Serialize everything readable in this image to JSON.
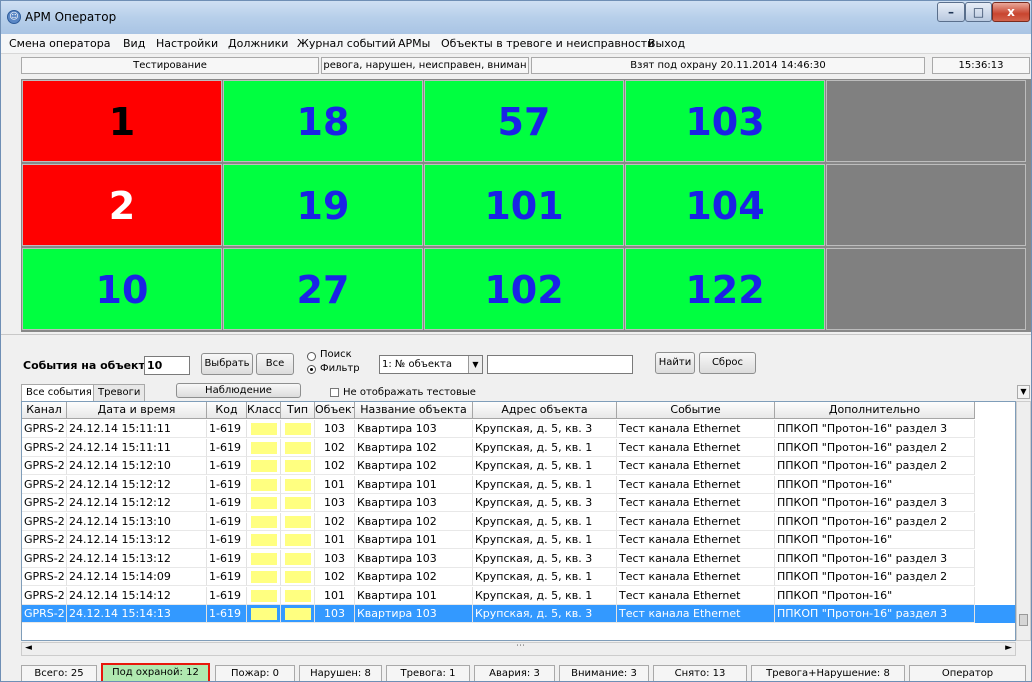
{
  "window": {
    "title": "АРМ Оператор",
    "min": "–",
    "max": "□",
    "close": "x"
  },
  "menu": [
    "Смена оператора",
    "Вид",
    "Настройки",
    "Должники",
    "Журнал событий",
    "АРМы",
    "Объекты в тревоге и неисправности",
    "Выход"
  ],
  "status_top": {
    "mode": "Тестирование",
    "filter": "ревога, нарушен, неисправен, вниман",
    "armed": "Взят под охрану 20.11.2014 14:46:30",
    "time": "15:36:13"
  },
  "grid": [
    [
      {
        "n": "1",
        "state": "red",
        "text": "black"
      },
      {
        "n": "18",
        "state": "green",
        "text": "blue"
      },
      {
        "n": "57",
        "state": "green",
        "text": "blue"
      },
      {
        "n": "103",
        "state": "green",
        "text": "blue"
      },
      {
        "n": "",
        "state": "gray",
        "text": "blue"
      }
    ],
    [
      {
        "n": "2",
        "state": "red",
        "text": "white"
      },
      {
        "n": "19",
        "state": "green",
        "text": "blue"
      },
      {
        "n": "101",
        "state": "green",
        "text": "blue"
      },
      {
        "n": "104",
        "state": "green",
        "text": "blue"
      },
      {
        "n": "",
        "state": "gray",
        "text": "blue"
      }
    ],
    [
      {
        "n": "10",
        "state": "green",
        "text": "blue"
      },
      {
        "n": "27",
        "state": "green",
        "text": "blue"
      },
      {
        "n": "102",
        "state": "green",
        "text": "blue"
      },
      {
        "n": "122",
        "state": "green",
        "text": "blue"
      },
      {
        "n": "",
        "state": "gray",
        "text": "blue"
      }
    ]
  ],
  "controls": {
    "events_label": "События на объекте",
    "object_value": "10",
    "select_btn": "Выбрать",
    "all_btn": "Все",
    "search_label": "Поиск",
    "filter_label": "Фильтр",
    "field_select": "1: № объекта",
    "find_btn": "Найти",
    "reset_btn": "Сброс"
  },
  "tabs": {
    "all": "Все события",
    "alarms": "Тревоги",
    "watch": "Наблюдение",
    "hide_test": "Не отображать тестовые"
  },
  "columns": [
    "Канал",
    "Дата и время",
    "Код",
    "Класс",
    "Тип",
    "Объект",
    "Название объекта",
    "Адрес объекта",
    "Событие",
    "Дополнительно"
  ],
  "rows": [
    [
      "GPRS-2",
      "24.12.14  15:11:11",
      "1-619",
      "103",
      "Квартира 103",
      "Крупская, д. 5, кв. 3",
      "Тест канала Ethernet",
      "ППКОП \"Протон-16\" раздел 3"
    ],
    [
      "GPRS-2",
      "24.12.14  15:11:11",
      "1-619",
      "102",
      "Квартира 102",
      "Крупская, д. 5, кв. 1",
      "Тест канала Ethernet",
      "ППКОП \"Протон-16\" раздел 2"
    ],
    [
      "GPRS-2",
      "24.12.14  15:12:10",
      "1-619",
      "102",
      "Квартира 102",
      "Крупская, д. 5, кв. 1",
      "Тест канала Ethernet",
      "ППКОП \"Протон-16\" раздел 2"
    ],
    [
      "GPRS-2",
      "24.12.14  15:12:12",
      "1-619",
      "101",
      "Квартира 101",
      "Крупская, д. 5, кв. 1",
      "Тест канала Ethernet",
      "ППКОП \"Протон-16\""
    ],
    [
      "GPRS-2",
      "24.12.14  15:12:12",
      "1-619",
      "103",
      "Квартира 103",
      "Крупская, д. 5, кв. 3",
      "Тест канала Ethernet",
      "ППКОП \"Протон-16\" раздел 3"
    ],
    [
      "GPRS-2",
      "24.12.14  15:13:10",
      "1-619",
      "102",
      "Квартира 102",
      "Крупская, д. 5, кв. 1",
      "Тест канала Ethernet",
      "ППКОП \"Протон-16\" раздел 2"
    ],
    [
      "GPRS-2",
      "24.12.14  15:13:12",
      "1-619",
      "101",
      "Квартира 101",
      "Крупская, д. 5, кв. 1",
      "Тест канала Ethernet",
      "ППКОП \"Протон-16\""
    ],
    [
      "GPRS-2",
      "24.12.14  15:13:12",
      "1-619",
      "103",
      "Квартира 103",
      "Крупская, д. 5, кв. 3",
      "Тест канала Ethernet",
      "ППКОП \"Протон-16\" раздел 3"
    ],
    [
      "GPRS-2",
      "24.12.14  15:14:09",
      "1-619",
      "102",
      "Квартира 102",
      "Крупская, д. 5, кв. 1",
      "Тест канала Ethernet",
      "ППКОП \"Протон-16\" раздел 2"
    ],
    [
      "GPRS-2",
      "24.12.14  15:14:12",
      "1-619",
      "101",
      "Квартира 101",
      "Крупская, д. 5, кв. 1",
      "Тест канала Ethernet",
      "ППКОП \"Протон-16\""
    ],
    [
      "GPRS-2",
      "24.12.14  15:14:13",
      "1-619",
      "103",
      "Квартира 103",
      "Крупская, д. 5, кв. 3",
      "Тест канала Ethernet",
      "ППКОП \"Протон-16\" раздел 3"
    ]
  ],
  "selected_row": 10,
  "bottom": {
    "total": "Всего: 25",
    "guarded": "Под охраной: 12",
    "fire": "Пожар: 0",
    "violated": "Нарушен: 8",
    "alarm": "Тревога: 1",
    "accident": "Авария: 3",
    "attention": "Внимание: 3",
    "removed": "Снято: 13",
    "alarm_violation": "Тревога+Нарушение: 8",
    "role": "Оператор"
  },
  "colors": {
    "red": "#ff0000",
    "green": "#00ff40",
    "gray": "#808080",
    "selection": "#3399ff",
    "highlight_border": "#e8170c"
  }
}
